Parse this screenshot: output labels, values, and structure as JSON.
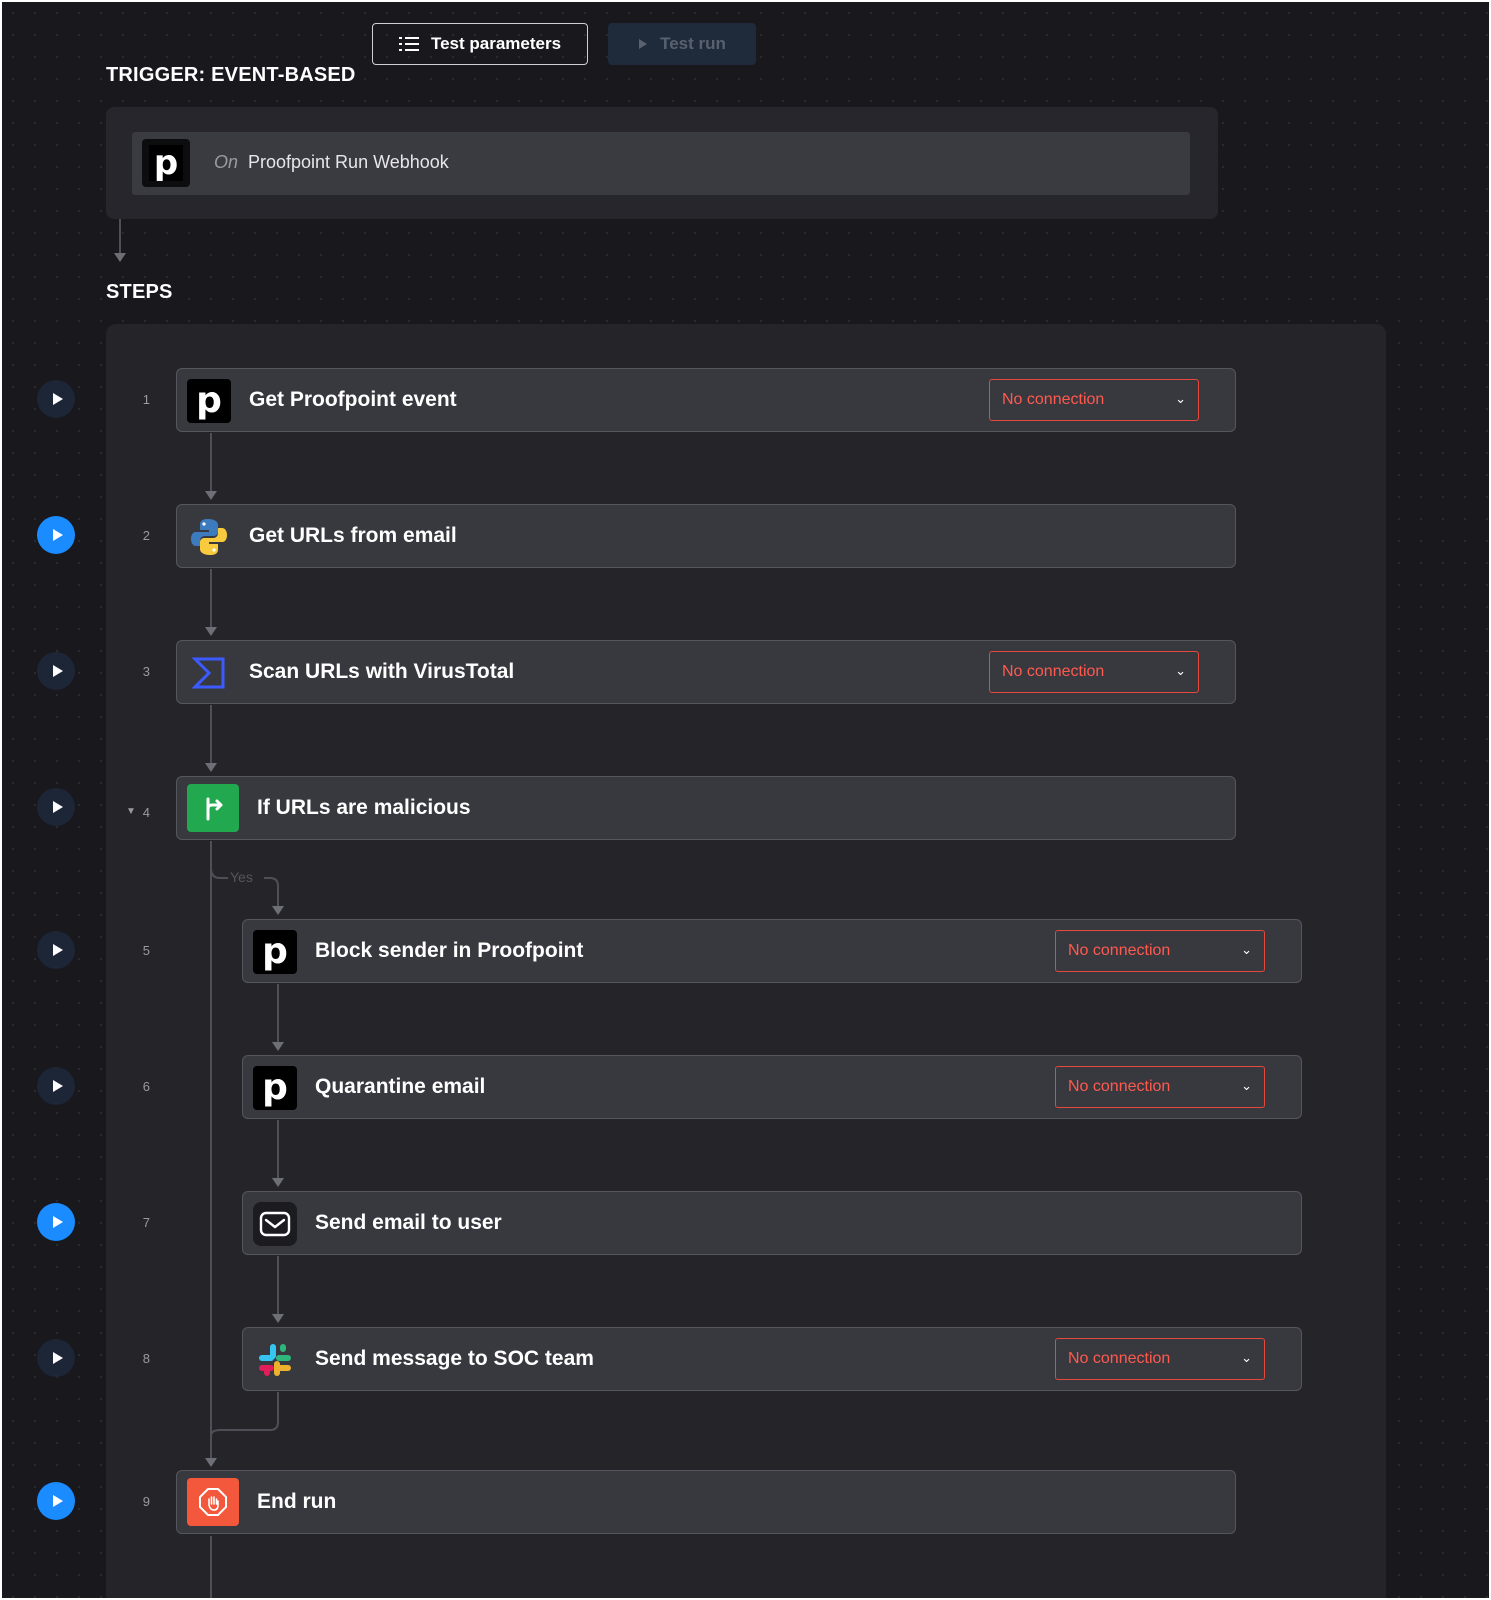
{
  "toolbar": {
    "test_parameters_label": "Test parameters",
    "test_run_label": "Test run"
  },
  "trigger": {
    "heading": "TRIGGER: EVENT-BASED",
    "prefix": "On",
    "name": "Proofpoint Run Webhook",
    "logo_letter": "p"
  },
  "steps_heading": "STEPS",
  "branch_label": "Yes",
  "steps": [
    {
      "number": "1",
      "title": "Get Proofpoint event",
      "icon": "proofpoint-icon",
      "connection": "No connection"
    },
    {
      "number": "2",
      "title": "Get URLs from email",
      "icon": "python-icon",
      "connection": ""
    },
    {
      "number": "3",
      "title": "Scan URLs with VirusTotal",
      "icon": "virustotal-icon",
      "connection": "No connection"
    },
    {
      "number": "4",
      "title": "If URLs are malicious",
      "icon": "condition-icon",
      "connection": ""
    },
    {
      "number": "5",
      "title": "Block sender in Proofpoint",
      "icon": "proofpoint-icon",
      "connection": "No connection"
    },
    {
      "number": "6",
      "title": "Quarantine email",
      "icon": "proofpoint-icon",
      "connection": "No connection"
    },
    {
      "number": "7",
      "title": "Send email to user",
      "icon": "email-icon",
      "connection": ""
    },
    {
      "number": "8",
      "title": "Send message to SOC team",
      "icon": "slack-icon",
      "connection": "No connection"
    },
    {
      "number": "9",
      "title": "End run",
      "icon": "stop-icon",
      "connection": ""
    }
  ],
  "colors": {
    "background": "#18181d",
    "card": "#38383f",
    "accent_blue": "#1a8cff",
    "error_red": "#e5483d",
    "condition_green": "#22a94f",
    "end_orange": "#f4583c"
  }
}
